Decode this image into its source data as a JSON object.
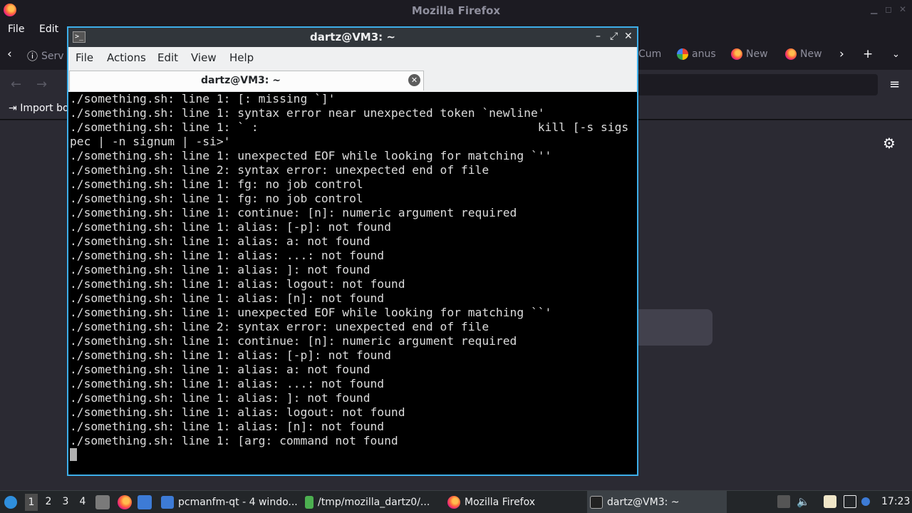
{
  "firefox": {
    "window_title": "Mozilla Firefox",
    "menu": [
      "File",
      "Edit"
    ],
    "tabs": [
      {
        "label": "Serv",
        "icon": "info-icon"
      },
      {
        "label": "Cum",
        "icon": "tab-icon"
      },
      {
        "label": "anus",
        "icon": "google-icon"
      },
      {
        "label": "New",
        "icon": "firefox-icon"
      },
      {
        "label": "New",
        "icon": "firefox-icon"
      }
    ],
    "import_bookmarks": "Import bo"
  },
  "terminal": {
    "window_title": "dartz@VM3: ~",
    "menu": [
      "File",
      "Actions",
      "Edit",
      "View",
      "Help"
    ],
    "tab_label": "dartz@VM3: ~",
    "lines": [
      "./something.sh: line 1: [: missing `]'",
      "./something.sh: line 1: syntax error near unexpected token `newline'",
      "./something.sh: line 1: ` :                                        kill [-s sigs",
      "pec | -n signum | -si>'",
      "./something.sh: line 1: unexpected EOF while looking for matching `''",
      "./something.sh: line 2: syntax error: unexpected end of file",
      "./something.sh: line 1: fg: no job control",
      "./something.sh: line 1: fg: no job control",
      "./something.sh: line 1: continue: [n]: numeric argument required",
      "./something.sh: line 1: alias: [-p]: not found",
      "./something.sh: line 1: alias: a: not found",
      "./something.sh: line 1: alias: ...: not found",
      "./something.sh: line 1: alias: ]: not found",
      "./something.sh: line 1: alias: logout: not found",
      "./something.sh: line 1: alias: [n]: not found",
      "./something.sh: line 1: unexpected EOF while looking for matching ``'",
      "./something.sh: line 2: syntax error: unexpected end of file",
      "./something.sh: line 1: continue: [n]: numeric argument required",
      "./something.sh: line 1: alias: [-p]: not found",
      "./something.sh: line 1: alias: a: not found",
      "./something.sh: line 1: alias: ...: not found",
      "./something.sh: line 1: alias: ]: not found",
      "./something.sh: line 1: alias: logout: not found",
      "./something.sh: line 1: alias: [n]: not found",
      "./something.sh: line 1: [arg: command not found"
    ]
  },
  "taskbar": {
    "workspaces": [
      "1",
      "2",
      "3",
      "4"
    ],
    "active_workspace": "1",
    "tasks": [
      {
        "label": "pcmanfm-qt - 4 windo...",
        "icon": "folder-icon"
      },
      {
        "label": "/tmp/mozilla_dartz0/...",
        "icon": "archive-icon"
      },
      {
        "label": "Mozilla Firefox",
        "icon": "firefox-icon"
      },
      {
        "label": "dartz@VM3: ~",
        "icon": "terminal-icon"
      }
    ],
    "clock": "17:23"
  }
}
